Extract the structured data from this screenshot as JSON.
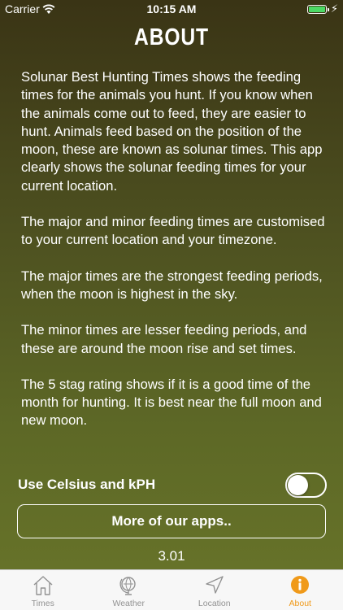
{
  "status": {
    "carrier": "Carrier",
    "time": "10:15 AM"
  },
  "title": "ABOUT",
  "paragraphs": [
    "Solunar Best Hunting Times shows the feeding times for the animals you hunt. If you know when the animals come out to feed, they are easier to hunt. Animals feed based on the position of the moon, these are known as solunar times. This app clearly shows the solunar feeding times for your current location.",
    "The major and minor feeding times are customised to your current location and your timezone.",
    "The major times are the strongest feeding periods, when the moon is highest in the sky.",
    "The minor times are lesser feeding periods, and these are around the moon rise and set times.",
    "The 5 stag rating shows if it is a good time of the month for hunting. It is best near the full moon and new moon."
  ],
  "settings": {
    "celsius_label": "Use Celsius and kPH",
    "celsius_on": false
  },
  "more_apps_label": "More of our apps..",
  "version": "3.01",
  "tabs": [
    {
      "label": "Times",
      "icon": "house-icon",
      "active": false
    },
    {
      "label": "Weather",
      "icon": "globe-icon",
      "active": false
    },
    {
      "label": "Location",
      "icon": "location-arrow-icon",
      "active": false
    },
    {
      "label": "About",
      "icon": "info-icon",
      "active": true
    }
  ],
  "colors": {
    "accent": "#f09a1a",
    "inactive_tab": "#929292",
    "battery": "#4cd964"
  }
}
